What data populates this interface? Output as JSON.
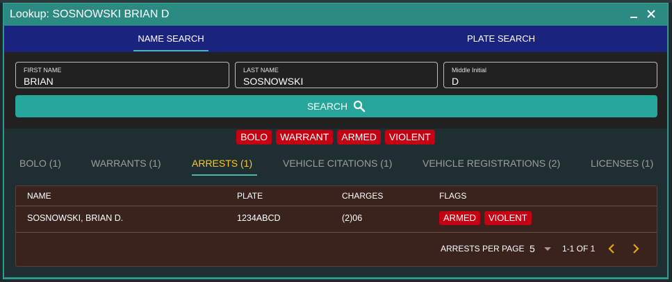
{
  "window": {
    "title": "Lookup: SOSNOWSKI BRIAN D"
  },
  "topnav": {
    "tabs": [
      "NAME SEARCH",
      "PLATE SEARCH"
    ],
    "active": "NAME SEARCH"
  },
  "form": {
    "fields": [
      {
        "label": "FIRST NAME",
        "value": "BRIAN"
      },
      {
        "label": "LAST NAME",
        "value": "SOSNOWSKI"
      },
      {
        "label": "Middle Initial",
        "value": "D"
      }
    ],
    "search_label": "SEARCH"
  },
  "flags": [
    "BOLO",
    "WARRANT",
    "ARMED",
    "VIOLENT"
  ],
  "subtabs": [
    "BOLO (1)",
    "WARRANTS (1)",
    "ARRESTS (1)",
    "VEHICLE CITATIONS (1)",
    "VEHICLE REGISTRATIONS (2)",
    "LICENSES (1)"
  ],
  "active_subtab": "ARRESTS (1)",
  "table": {
    "headers": [
      "NAME",
      "PLATE",
      "CHARGES",
      "FLAGS"
    ],
    "rows": [
      {
        "name": "SOSNOWSKI, BRIAN D.",
        "plate": "1234ABCD",
        "charges": "(2)06",
        "flags": [
          "ARMED",
          "VIOLENT"
        ]
      }
    ],
    "pager": {
      "per_page_label": "ARRESTS PER PAGE",
      "per_page": "5",
      "range": "1-1 OF 1"
    }
  },
  "colors": {
    "titlebar": "#2b8b83",
    "topnav": "#1a237e",
    "accent": "#26a69a",
    "flag": "#c40012",
    "active_tab": "#ffca28",
    "table_bg": "#3a231d"
  },
  "icons": {
    "minimize": "minimize-icon",
    "close": "close-icon",
    "search": "search-icon",
    "dropdown": "caret-down-icon",
    "prev": "chevron-left-icon",
    "next": "chevron-right-icon"
  }
}
